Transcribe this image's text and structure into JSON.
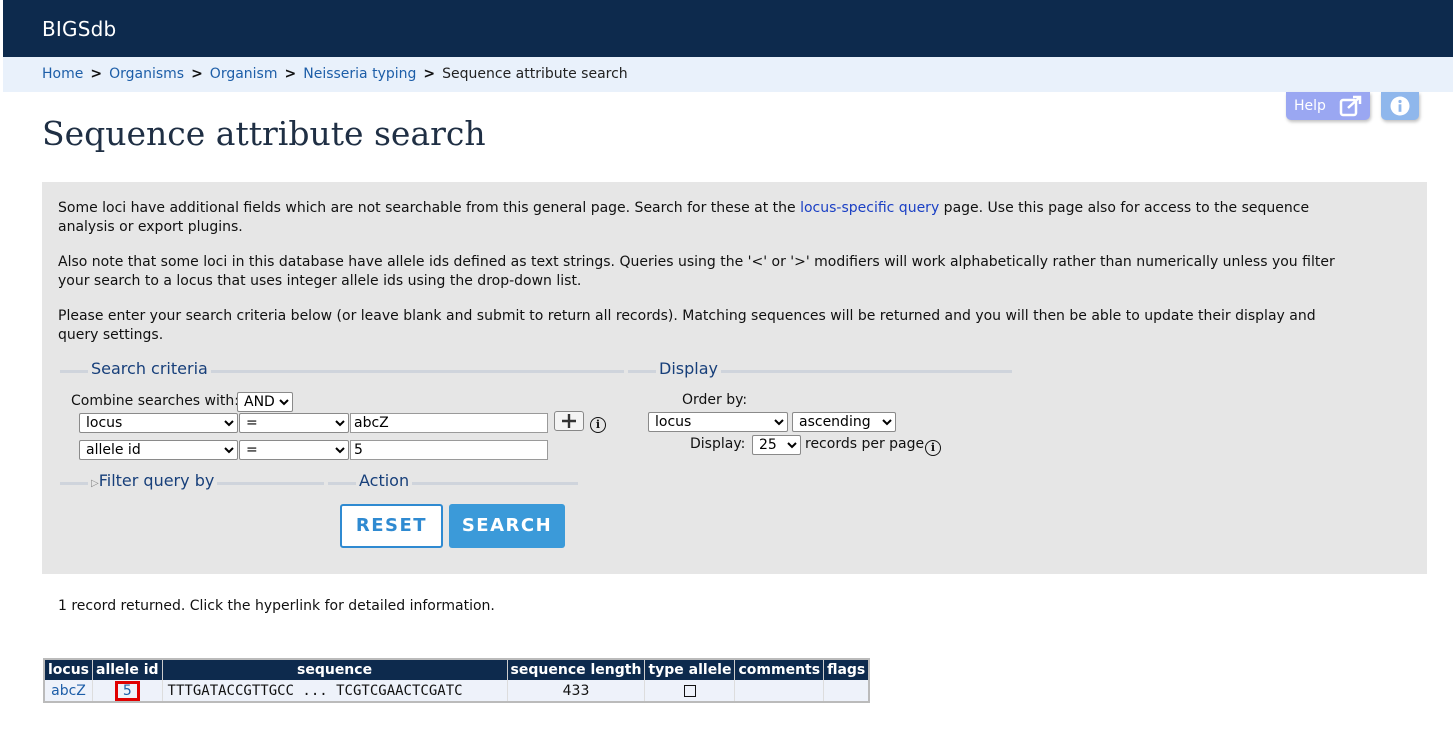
{
  "app": {
    "brand": "BIGSdb"
  },
  "breadcrumb": {
    "items": [
      "Home",
      "Organisms",
      "Organism",
      "Neisseria typing"
    ],
    "separator": ">",
    "current": "Sequence attribute search"
  },
  "top_buttons": {
    "help_label": "Help"
  },
  "page_title": "Sequence attribute search",
  "intro": {
    "p1_before": "Some loci have additional fields which are not searchable from this general page. Search for these at the ",
    "p1_link": "locus-specific query",
    "p1_after": " page. Use this page also for access to the sequence analysis or export plugins.",
    "p2": "Also note that some loci in this database have allele ids defined as text strings. Queries using the '<' or '>' modifiers will work alphabetically rather than numerically unless you filter your search to a locus that uses integer allele ids using the drop-down list.",
    "p3": "Please enter your search criteria below (or leave blank and submit to return all records). Matching sequences will be returned and you will then be able to update their display and query settings."
  },
  "search_criteria": {
    "legend": "Search criteria",
    "combine_label": "Combine searches with:",
    "combine_value": "AND",
    "rows": [
      {
        "field": "locus",
        "operator": "=",
        "value": "abcZ"
      },
      {
        "field": "allele id",
        "operator": "=",
        "value": "5"
      }
    ]
  },
  "display": {
    "legend": "Display",
    "order_by_label": "Order by:",
    "order_by_value": "locus",
    "direction_value": "ascending",
    "display_label": "Display:",
    "per_page_value": "25",
    "per_page_suffix": "records per page"
  },
  "filter": {
    "legend": "Filter query by",
    "arrow": "▷"
  },
  "action": {
    "legend": "Action",
    "reset_label": "RESET",
    "search_label": "SEARCH"
  },
  "results": {
    "message": "1 record returned. Click the hyperlink for detailed information.",
    "headers": [
      "locus",
      "allele id",
      "sequence",
      "sequence length",
      "type allele",
      "comments",
      "flags"
    ],
    "row": {
      "locus": "abcZ",
      "allele_id": "5",
      "sequence": "TTTGATACCGTTGCC ... TCGTCGAACTCGATC",
      "length": "433",
      "type_allele": false,
      "comments": "",
      "flags": ""
    }
  },
  "colors": {
    "header_bg": "#0d2a4d",
    "accent": "#3b9ad9",
    "highlight": "#e00000"
  }
}
